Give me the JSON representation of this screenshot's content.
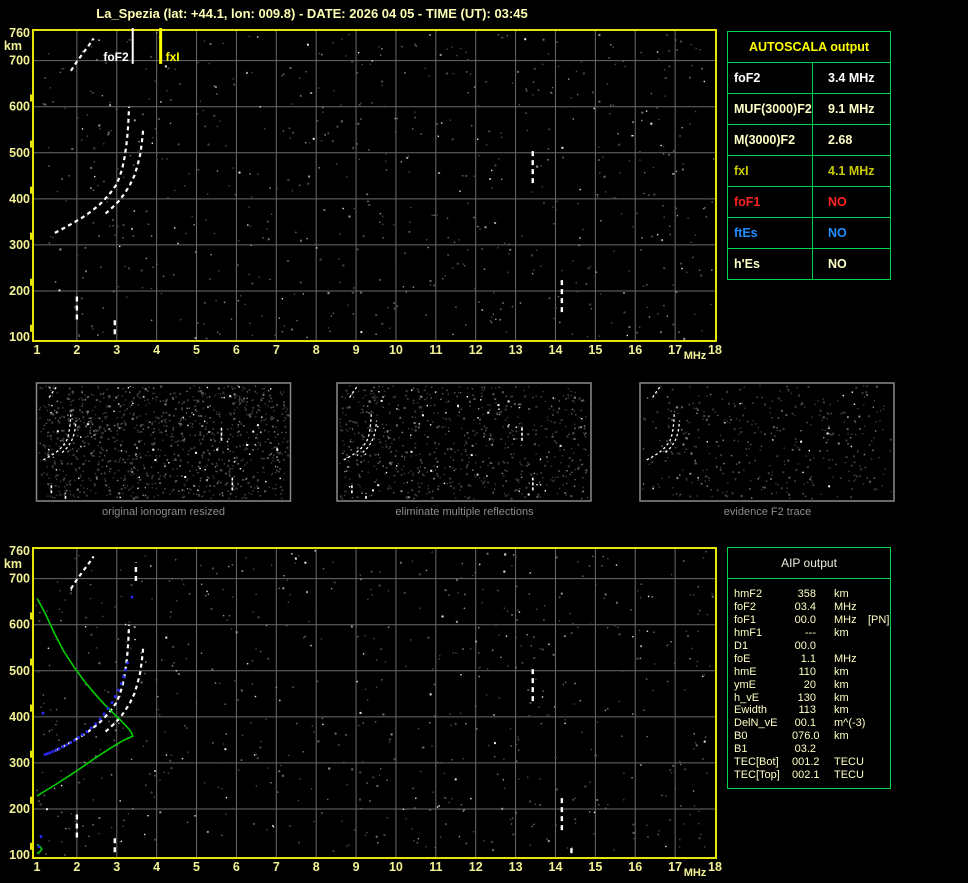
{
  "title": "La_Spezia (lat: +44.1, lon: 009.8) - DATE: 2026 04 05 - TIME (UT): 03:45",
  "colors": {
    "background": "#000000",
    "plot_border": "#e6e600",
    "grid": "#6a6a6a",
    "axis_label": "#f2f296",
    "table_border": "#00d24a",
    "pale_yellow": "#ffffc8",
    "bright_yellow": "#ffff00",
    "profile_green": "#00d000",
    "scaled_points_blue": "#2a2aff"
  },
  "autoscala_table": {
    "header": "AUTOSCALA output",
    "rows": [
      {
        "label": "foF2",
        "value": "3.4 MHz",
        "color": "#ffffff"
      },
      {
        "label": "MUF(3000)F2",
        "value": "9.1 MHz",
        "color": "#ffffc8"
      },
      {
        "label": "M(3000)F2",
        "value": "2.68",
        "color": "#ffffc8"
      },
      {
        "label": "fxI",
        "value": "4.1 MHz",
        "color": "#c9c900"
      },
      {
        "label": "foF1",
        "value": "NO",
        "color": "#ff2222"
      },
      {
        "label": "ftEs",
        "value": "NO",
        "color": "#1e8fff"
      },
      {
        "label": "h'Es",
        "value": "NO",
        "color": "#ffffc8"
      }
    ]
  },
  "aip_table": {
    "header": "AIP output",
    "rows": [
      {
        "label": "hmF2",
        "value": "358",
        "unit": "km",
        "extra": ""
      },
      {
        "label": "foF2",
        "value": "03.4",
        "unit": "MHz",
        "extra": ""
      },
      {
        "label": "foF1",
        "value": "00.0",
        "unit": "MHz",
        "extra": "[PN]"
      },
      {
        "label": "hmF1",
        "value": "---",
        "unit": "km",
        "extra": ""
      },
      {
        "label": "D1",
        "value": "00.0",
        "unit": "",
        "extra": ""
      },
      {
        "label": "foE",
        "value": "1.1",
        "unit": "MHz",
        "extra": ""
      },
      {
        "label": "hmE",
        "value": "110",
        "unit": "km",
        "extra": ""
      },
      {
        "label": "ymE",
        "value": "20",
        "unit": "km",
        "extra": ""
      },
      {
        "label": "h_vE",
        "value": "130",
        "unit": "km",
        "extra": ""
      },
      {
        "label": "Ewidth",
        "value": "113",
        "unit": "km",
        "extra": ""
      },
      {
        "label": "DelN_vE",
        "value": "00.1",
        "unit": "m^(-3)",
        "extra": ""
      },
      {
        "label": "B0",
        "value": "076.0",
        "unit": "km",
        "extra": ""
      },
      {
        "label": "B1",
        "value": "03.2",
        "unit": "",
        "extra": ""
      },
      {
        "label": "TEC[Bot]",
        "value": "001.2",
        "unit": "TECU",
        "extra": ""
      },
      {
        "label": "TEC[Top]",
        "value": "002.1",
        "unit": "TECU",
        "extra": ""
      }
    ]
  },
  "thumbnails": [
    {
      "caption": "original ionogram resized"
    },
    {
      "caption": "eliminate multiple reflections"
    },
    {
      "caption": "evidence F2 trace"
    }
  ],
  "chart_data": [
    {
      "id": "main-ionogram",
      "type": "scatter",
      "title": "scaled ionogram with AUTOSCALA markers",
      "xlabel": "MHz",
      "ylabel": "km",
      "xlim": [
        1,
        18
      ],
      "ylim": [
        100,
        760
      ],
      "x_ticks": [
        1,
        2,
        3,
        4,
        5,
        6,
        7,
        8,
        9,
        10,
        11,
        12,
        13,
        14,
        15,
        16,
        17,
        18
      ],
      "y_ticks": [
        760,
        700,
        600,
        500,
        400,
        300,
        200,
        100
      ],
      "grid": true,
      "annotations": [
        {
          "label": "foF2",
          "x": 3.4,
          "color": "#ffffff",
          "side": "left"
        },
        {
          "label": "fxI",
          "x": 4.1,
          "color": "#ffff00",
          "side": "right"
        }
      ],
      "series": [
        {
          "name": "F2 ordinary trace",
          "type": "dashed-line",
          "color": "#ffffff",
          "points": [
            [
              1.45,
              326
            ],
            [
              1.6,
              333
            ],
            [
              1.75,
              340
            ],
            [
              1.95,
              350
            ],
            [
              2.15,
              360
            ],
            [
              2.35,
              372
            ],
            [
              2.55,
              386
            ],
            [
              2.7,
              399
            ],
            [
              2.85,
              414
            ],
            [
              3.0,
              432
            ],
            [
              3.08,
              450
            ],
            [
              3.15,
              470
            ],
            [
              3.2,
              492
            ],
            [
              3.24,
              515
            ],
            [
              3.27,
              540
            ],
            [
              3.29,
              565
            ],
            [
              3.31,
              600
            ]
          ]
        },
        {
          "name": "F2 extraordinary trace",
          "type": "dashed-line",
          "color": "#ffffff",
          "points": [
            [
              2.72,
              368
            ],
            [
              2.9,
              382
            ],
            [
              3.06,
              396
            ],
            [
              3.2,
              412
            ],
            [
              3.33,
              430
            ],
            [
              3.44,
              450
            ],
            [
              3.52,
              472
            ],
            [
              3.59,
              497
            ],
            [
              3.63,
              523
            ],
            [
              3.66,
              548
            ]
          ]
        },
        {
          "name": "second hop echo",
          "type": "dashed-line",
          "color": "#ffffff",
          "points": [
            [
              1.85,
              678
            ],
            [
              2.0,
              698
            ],
            [
              2.15,
              716
            ],
            [
              2.3,
              733
            ],
            [
              2.42,
              748
            ]
          ]
        },
        {
          "name": "vertical echoes",
          "type": "vsegments",
          "color": "#ffffff",
          "segments": [
            [
              2.0,
              138,
              196
            ],
            [
              2.95,
              106,
              138
            ],
            [
              13.43,
              434,
              508
            ],
            [
              14.16,
              154,
              226
            ]
          ]
        }
      ]
    },
    {
      "id": "aip-ionogram",
      "type": "scatter",
      "title": "ionogram with AIP inversion profile",
      "xlabel": "MHz",
      "ylabel": "km",
      "xlim": [
        1,
        18
      ],
      "ylim": [
        100,
        760
      ],
      "x_ticks": [
        1,
        2,
        3,
        4,
        5,
        6,
        7,
        8,
        9,
        10,
        11,
        12,
        13,
        14,
        15,
        16,
        17,
        18
      ],
      "y_ticks": [
        760,
        700,
        600,
        500,
        400,
        300,
        200,
        100
      ],
      "grid": true,
      "annotations": [],
      "series": [
        {
          "name": "F2 ordinary trace",
          "type": "dashed-line",
          "color": "#ffffff",
          "points": [
            [
              1.45,
              326
            ],
            [
              1.6,
              333
            ],
            [
              1.75,
              340
            ],
            [
              1.95,
              350
            ],
            [
              2.15,
              360
            ],
            [
              2.35,
              372
            ],
            [
              2.55,
              386
            ],
            [
              2.7,
              399
            ],
            [
              2.85,
              414
            ],
            [
              3.0,
              432
            ],
            [
              3.08,
              450
            ],
            [
              3.15,
              470
            ],
            [
              3.2,
              492
            ],
            [
              3.24,
              515
            ],
            [
              3.27,
              540
            ],
            [
              3.29,
              565
            ],
            [
              3.31,
              600
            ]
          ]
        },
        {
          "name": "F2 extraordinary trace",
          "type": "dashed-line",
          "color": "#ffffff",
          "points": [
            [
              2.72,
              368
            ],
            [
              2.9,
              382
            ],
            [
              3.06,
              396
            ],
            [
              3.2,
              412
            ],
            [
              3.33,
              430
            ],
            [
              3.44,
              450
            ],
            [
              3.52,
              472
            ],
            [
              3.59,
              497
            ],
            [
              3.63,
              523
            ],
            [
              3.66,
              548
            ]
          ]
        },
        {
          "name": "second hop echo",
          "type": "dashed-line",
          "color": "#ffffff",
          "points": [
            [
              1.85,
              678
            ],
            [
              2.0,
              698
            ],
            [
              2.15,
              716
            ],
            [
              2.3,
              733
            ],
            [
              2.42,
              748
            ]
          ]
        },
        {
          "name": "vertical echoes",
          "type": "vsegments",
          "color": "#ffffff",
          "segments": [
            [
              2.0,
              138,
              196
            ],
            [
              2.95,
              106,
              138
            ],
            [
              13.43,
              434,
              508
            ],
            [
              14.16,
              154,
              226
            ],
            [
              3.48,
              695,
              735
            ],
            [
              14.4,
              104,
              122
            ]
          ]
        },
        {
          "name": "electron density profile",
          "type": "line",
          "color": "#00d000",
          "points": [
            [
              1.0,
              228
            ],
            [
              1.2,
              239
            ],
            [
              1.45,
              252
            ],
            [
              1.7,
              266
            ],
            [
              1.95,
              280
            ],
            [
              2.2,
              295
            ],
            [
              2.45,
              310
            ],
            [
              2.7,
              324
            ],
            [
              2.95,
              338
            ],
            [
              3.15,
              348
            ],
            [
              3.3,
              354
            ],
            [
              3.4,
              358
            ],
            [
              3.36,
              367
            ],
            [
              3.26,
              378
            ],
            [
              3.1,
              392
            ],
            [
              2.9,
              409
            ],
            [
              2.68,
              428
            ],
            [
              2.44,
              451
            ],
            [
              2.18,
              478
            ],
            [
              1.92,
              509
            ],
            [
              1.66,
              544
            ],
            [
              1.42,
              584
            ],
            [
              1.22,
              622
            ],
            [
              1.08,
              645
            ],
            [
              1.0,
              657
            ]
          ]
        },
        {
          "name": "E-layer profile bump",
          "type": "line",
          "color": "#00d000",
          "points": [
            [
              1.0,
              103
            ],
            [
              1.08,
              108
            ],
            [
              1.12,
              113
            ],
            [
              1.08,
              118
            ],
            [
              1.0,
              123
            ]
          ]
        },
        {
          "name": "scaled trace points",
          "type": "points",
          "color": "#2a2aff",
          "points": [
            [
              1.2,
              318
            ],
            [
              1.26,
              320
            ],
            [
              1.33,
              322
            ],
            [
              1.4,
              325
            ],
            [
              1.48,
              328
            ],
            [
              1.56,
              331
            ],
            [
              1.65,
              335
            ],
            [
              1.74,
              339
            ],
            [
              1.84,
              344
            ],
            [
              1.94,
              349
            ],
            [
              2.04,
              355
            ],
            [
              2.14,
              361
            ],
            [
              2.25,
              368
            ],
            [
              2.36,
              376
            ],
            [
              2.47,
              385
            ],
            [
              2.58,
              395
            ],
            [
              2.68,
              406
            ],
            [
              2.78,
              418
            ],
            [
              2.88,
              431
            ],
            [
              2.96,
              444
            ],
            [
              3.04,
              458
            ],
            [
              3.11,
              472
            ],
            [
              3.17,
              487
            ],
            [
              3.22,
              502
            ],
            [
              3.27,
              517
            ]
          ]
        },
        {
          "name": "isolated scaled points",
          "type": "points",
          "color": "#2a2aff",
          "points": [
            [
              1.15,
              408
            ],
            [
              3.38,
              660
            ],
            [
              1.1,
              140
            ],
            [
              1.05,
              118
            ]
          ]
        }
      ]
    }
  ]
}
